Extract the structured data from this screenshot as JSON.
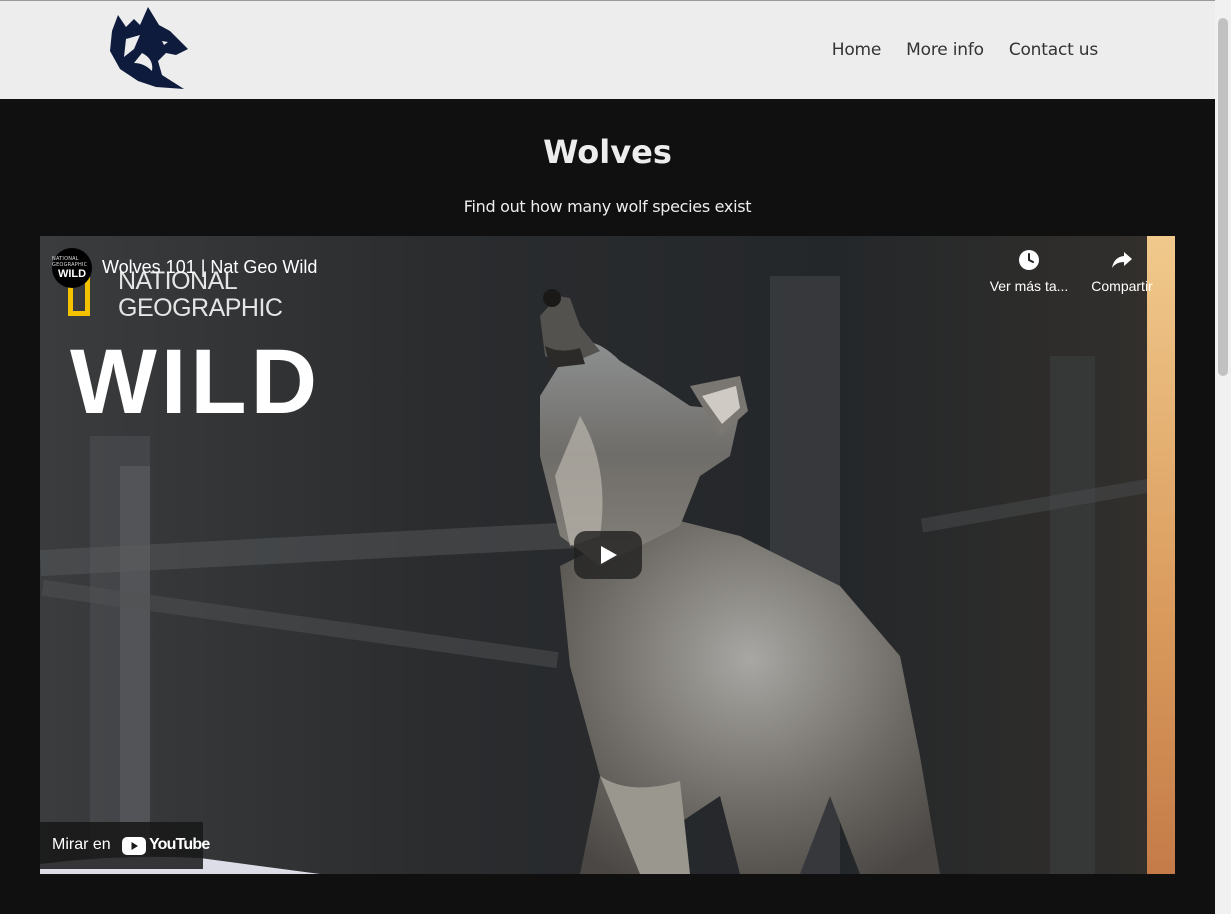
{
  "nav": {
    "logo_icon": "wolf-head-logo",
    "links": [
      "Home",
      "More info",
      "Contact us"
    ]
  },
  "hero": {
    "title": "Wolves",
    "subtitle": "Find out how many wolf species exist"
  },
  "video": {
    "title": "Wolves 101 | Nat Geo Wild",
    "channel_avatar_top": "NATIONAL GEOGRAPHIC",
    "channel_avatar_main": "WILD",
    "brand_line1": "NATIONAL",
    "brand_line2": "GEOGRAPHIC",
    "brand_wild": "WILD",
    "watch_later_label": "Ver más ta...",
    "share_label": "Compartir",
    "watch_on_label": "Mirar en",
    "youtube_label": "YouTube"
  },
  "colors": {
    "navbar_bg": "#ededed",
    "page_bg": "#101010",
    "logo_navy": "#0f1b3d",
    "brand_yellow": "#f3c300"
  }
}
